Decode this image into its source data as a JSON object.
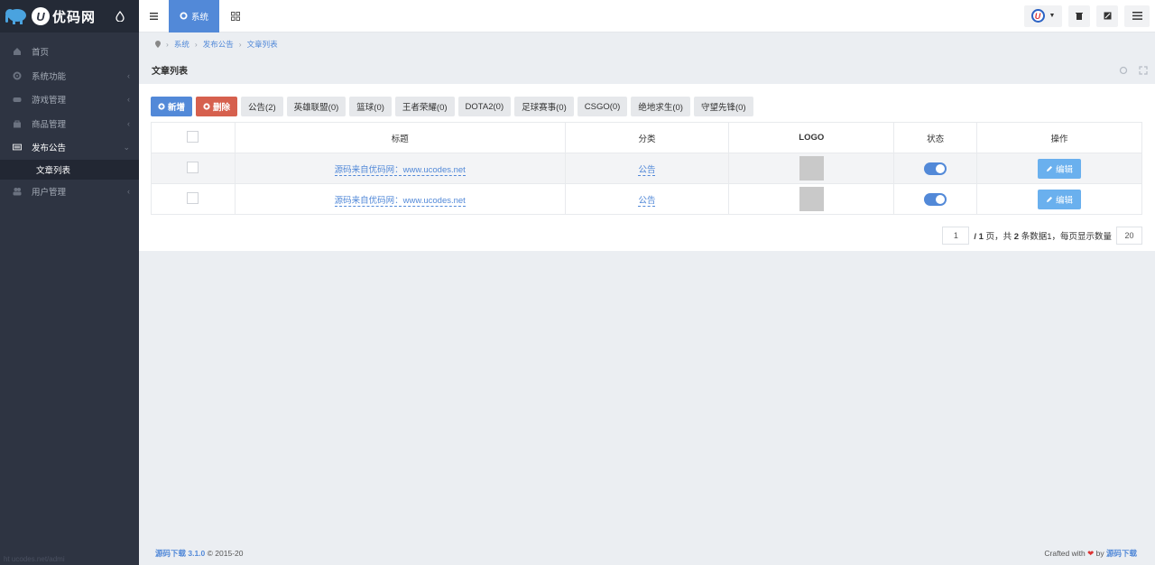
{
  "sidebar": {
    "logo_text": "优码网",
    "items": [
      {
        "label": "首页",
        "icon": "home-icon",
        "has_chevron": false
      },
      {
        "label": "系统功能",
        "icon": "gear-icon",
        "has_chevron": true
      },
      {
        "label": "游戏管理",
        "icon": "gamepad-icon",
        "has_chevron": true
      },
      {
        "label": "商品管理",
        "icon": "bag-icon",
        "has_chevron": true
      },
      {
        "label": "发布公告",
        "icon": "newspaper-icon",
        "has_chevron": true,
        "active": true
      },
      {
        "label": "用户管理",
        "icon": "users-icon",
        "has_chevron": true
      }
    ],
    "sub_item": "文章列表",
    "status_text": "ht ucodes.net/admi"
  },
  "topbar": {
    "tab_label": "系统"
  },
  "breadcrumb": [
    "系统",
    "发布公告",
    "文章列表"
  ],
  "panel": {
    "title": "文章列表"
  },
  "buttons": {
    "add": "新增",
    "delete": "删除",
    "filters": [
      "公告(2)",
      "英雄联盟(0)",
      "篮球(0)",
      "王者荣耀(0)",
      "DOTA2(0)",
      "足球赛事(0)",
      "CSGO(0)",
      "绝地求生(0)",
      "守望先锋(0)"
    ]
  },
  "table": {
    "headers": [
      "标题",
      "分类",
      "LOGO",
      "状态",
      "操作"
    ],
    "rows": [
      {
        "title": "源码来自优码网：www.ucodes.net",
        "category": "公告",
        "status": "on",
        "action": "编辑"
      },
      {
        "title": "源码来自优码网：www.ucodes.net",
        "category": "公告",
        "status": "on",
        "action": "编辑"
      }
    ]
  },
  "pagination": {
    "current_page": "1",
    "text_pre": "/",
    "total_pages": "1",
    "text_mid1": "页，共",
    "total_items": "2",
    "text_mid2": "条数据1，每页显示数量",
    "page_size": "20"
  },
  "footer": {
    "left_brand": "源码下载 3.1.0",
    "left_rest": "© 2015-20",
    "right_pre": "Crafted with",
    "right_by": "by",
    "right_brand": "源码下载"
  },
  "colors": {
    "accent": "#5289d8",
    "danger": "#d6604e",
    "sidebar_bg": "#2e3442",
    "edit_btn": "#6ab0ee"
  }
}
